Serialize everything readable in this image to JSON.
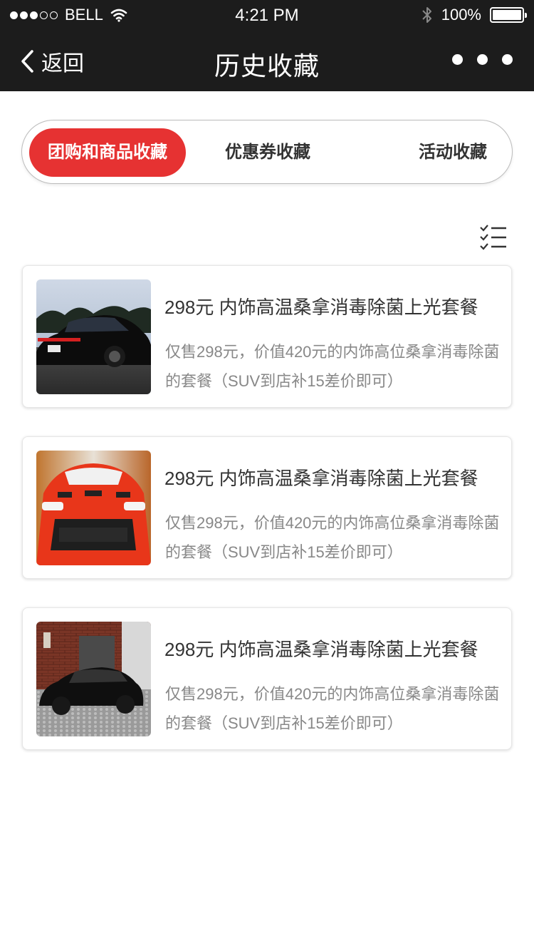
{
  "status_bar": {
    "carrier": "BELL",
    "time": "4:21 PM",
    "battery_percent": "100%",
    "signal_bars_filled": 3,
    "signal_bars_total": 5
  },
  "nav": {
    "back_label": "返回",
    "title": "历史收藏",
    "more_icon": "more-dots-icon"
  },
  "tabs": [
    {
      "label": "团购和商品收藏",
      "active": true
    },
    {
      "label": "优惠券收藏",
      "active": false
    },
    {
      "label": "活动收藏",
      "active": false
    }
  ],
  "edit_icon": "checklist-icon",
  "items": [
    {
      "title": "298元 内饰高温桑拿消毒除菌上光套餐",
      "desc": "仅售298元，价值420元的内饰高位桑拿消毒除菌的套餐（SUV到店补15差价即可）"
    },
    {
      "title": "298元 内饰高温桑拿消毒除菌上光套餐",
      "desc": "仅售298元，价值420元的内饰高位桑拿消毒除菌的套餐（SUV到店补15差价即可）"
    },
    {
      "title": "298元 内饰高温桑拿消毒除菌上光套餐",
      "desc": "仅售298元，价值420元的内饰高位桑拿消毒除菌的套餐（SUV到店补15差价即可）"
    }
  ],
  "colors": {
    "accent": "#e63232",
    "header_bg": "#1c1c1c"
  }
}
